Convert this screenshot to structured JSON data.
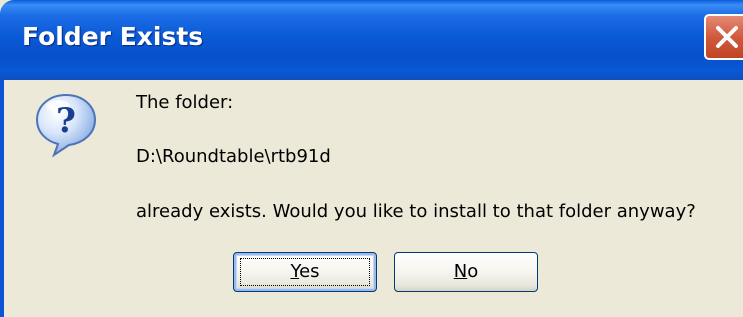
{
  "dialog": {
    "title": "Folder Exists",
    "icon": "question-icon",
    "message_line1": "The folder:",
    "folder_path": "D:\\Roundtable\\rtb91d",
    "message_line3": "already exists. Would you like to install to that folder anyway?"
  },
  "buttons": {
    "yes": {
      "accel": "Y",
      "rest": "es"
    },
    "no": {
      "accel": "N",
      "rest": "o"
    }
  },
  "colors": {
    "title_bar": "#0b5ad6",
    "dialog_background": "#ece9d8",
    "close_button": "#d15a3c"
  }
}
